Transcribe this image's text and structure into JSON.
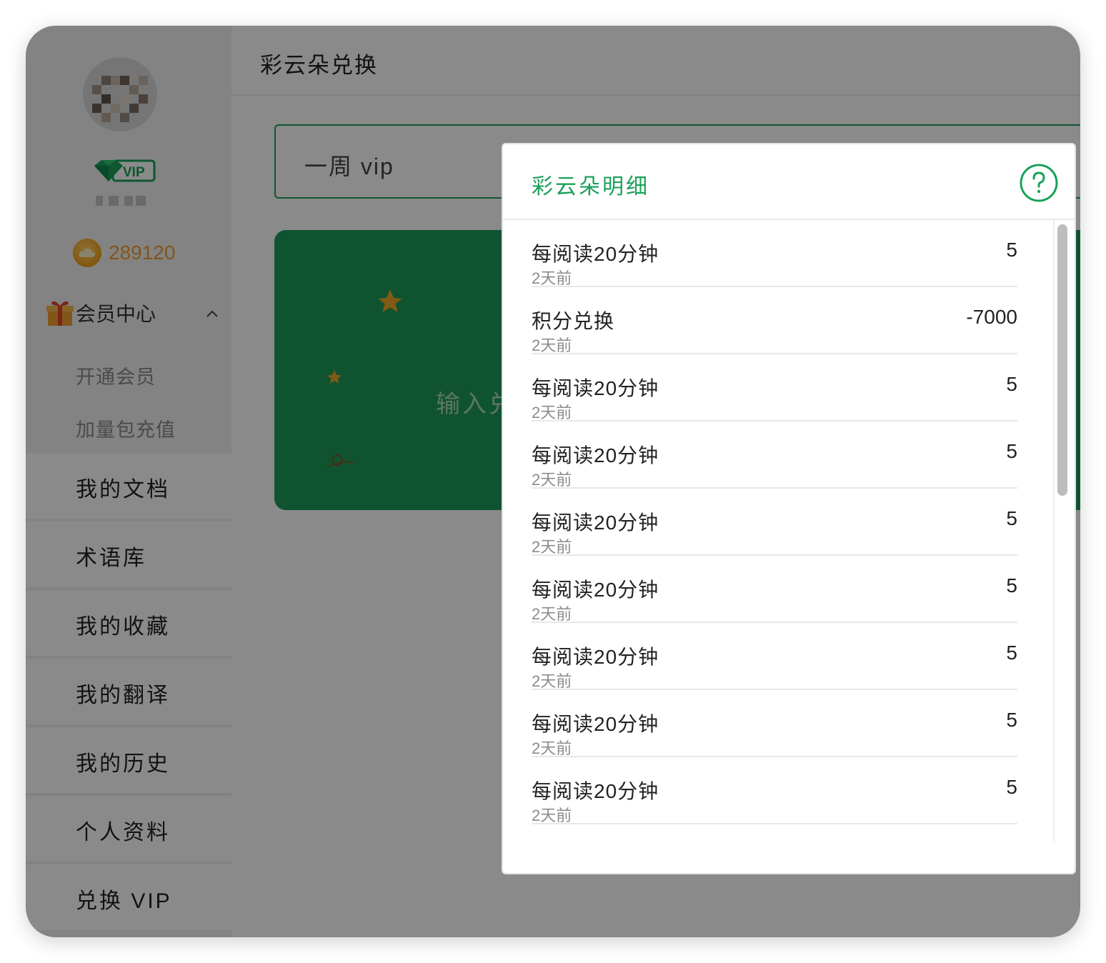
{
  "sidebar": {
    "vip_badge": "VIP",
    "coins": "289120",
    "group": {
      "label": "会员中心",
      "expanded": true
    },
    "sub_items": [
      {
        "label": "开通会员"
      },
      {
        "label": "加量包充值"
      }
    ],
    "nav_items": [
      {
        "label": "我的文档"
      },
      {
        "label": "术语库"
      },
      {
        "label": "我的收藏"
      },
      {
        "label": "我的翻译"
      },
      {
        "label": "我的历史"
      },
      {
        "label": "个人资料"
      },
      {
        "label": "兑换 VIP"
      }
    ]
  },
  "main": {
    "title": "彩云朵兑换",
    "code_input_value": "一周 vip",
    "hero_text": "输入兑"
  },
  "modal": {
    "title": "彩云朵明细",
    "help_icon": "question-circle-icon",
    "rows": [
      {
        "title": "每阅读20分钟",
        "time": "2天前",
        "amount": "5"
      },
      {
        "title": "积分兑换",
        "time": "2天前",
        "amount": "-7000"
      },
      {
        "title": "每阅读20分钟",
        "time": "2天前",
        "amount": "5"
      },
      {
        "title": "每阅读20分钟",
        "time": "2天前",
        "amount": "5"
      },
      {
        "title": "每阅读20分钟",
        "time": "2天前",
        "amount": "5"
      },
      {
        "title": "每阅读20分钟",
        "time": "2天前",
        "amount": "5"
      },
      {
        "title": "每阅读20分钟",
        "time": "2天前",
        "amount": "5"
      },
      {
        "title": "每阅读20分钟",
        "time": "2天前",
        "amount": "5"
      },
      {
        "title": "每阅读20分钟",
        "time": "2天前",
        "amount": "5"
      }
    ]
  },
  "colors": {
    "brand_green": "#1aa15a",
    "coin_orange": "#f0a030"
  }
}
